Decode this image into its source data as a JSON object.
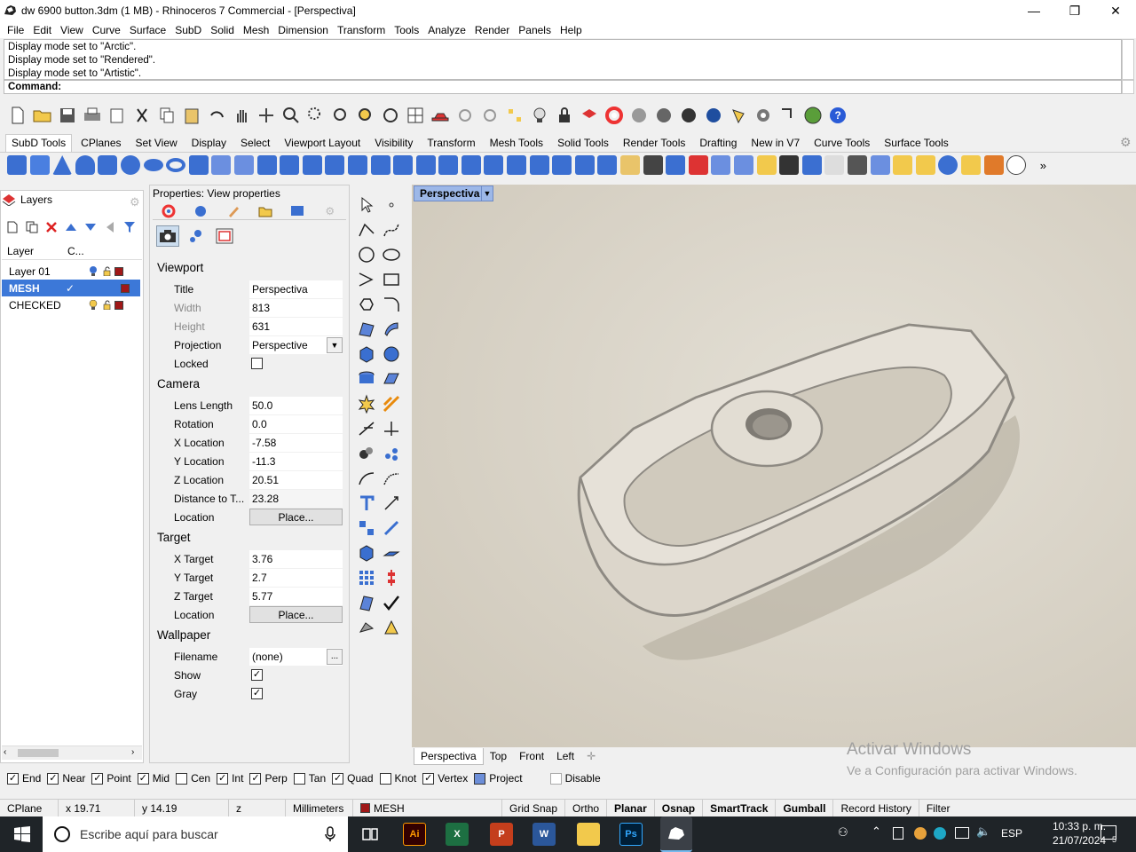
{
  "window": {
    "title": "dw 6900 button.3dm (1 MB) - Rhinoceros 7 Commercial - [Perspectiva]",
    "controls": [
      "—",
      "❐",
      "✕"
    ]
  },
  "menu": [
    "File",
    "Edit",
    "View",
    "Curve",
    "Surface",
    "SubD",
    "Solid",
    "Mesh",
    "Dimension",
    "Transform",
    "Tools",
    "Analyze",
    "Render",
    "Panels",
    "Help"
  ],
  "command": {
    "history": [
      "Display mode set to \"Arctic\".",
      "Display mode set to \"Rendered\".",
      "Display mode set to \"Artistic\"."
    ],
    "prompt": "Command:"
  },
  "toolbar_tabs": [
    {
      "label": "SubD Tools",
      "active": true
    },
    {
      "label": "CPlanes"
    },
    {
      "label": "Set View"
    },
    {
      "label": "Display"
    },
    {
      "label": "Select"
    },
    {
      "label": "Viewport Layout"
    },
    {
      "label": "Visibility"
    },
    {
      "label": "Transform"
    },
    {
      "label": "Mesh Tools"
    },
    {
      "label": "Solid Tools"
    },
    {
      "label": "Render Tools"
    },
    {
      "label": "Drafting"
    },
    {
      "label": "New in V7"
    },
    {
      "label": "Curve Tools"
    },
    {
      "label": "Surface Tools"
    }
  ],
  "layers": {
    "tab_label": "Layers",
    "col_layer": "Layer",
    "col_current": "C...",
    "rows": [
      {
        "name": "Layer 01",
        "current": "",
        "color": "#a01818",
        "selected": false
      },
      {
        "name": "MESH",
        "current": "✓",
        "color": "#a01818",
        "selected": true
      },
      {
        "name": "CHECKED",
        "current": "",
        "color": "#a01818",
        "selected": false
      }
    ]
  },
  "properties": {
    "title": "Properties: View properties",
    "viewport": {
      "section": "Viewport",
      "title_label": "Title",
      "title_value": "Perspectiva",
      "width_label": "Width",
      "width_value": "813",
      "height_label": "Height",
      "height_value": "631",
      "projection_label": "Projection",
      "projection_value": "Perspective",
      "locked_label": "Locked"
    },
    "camera": {
      "section": "Camera",
      "lens_label": "Lens Length",
      "lens_value": "50.0",
      "rotation_label": "Rotation",
      "rotation_value": "0.0",
      "xloc_label": "X Location",
      "xloc_value": "-7.58",
      "yloc_label": "Y Location",
      "yloc_value": "-11.3",
      "zloc_label": "Z Location",
      "zloc_value": "20.51",
      "dist_label": "Distance to T...",
      "dist_value": "23.28",
      "location_label": "Location",
      "place_button": "Place..."
    },
    "target": {
      "section": "Target",
      "xt_label": "X Target",
      "xt_value": "3.76",
      "yt_label": "Y Target",
      "yt_value": "2.7",
      "zt_label": "Z Target",
      "zt_value": "5.77",
      "location_label": "Location",
      "place_button": "Place..."
    },
    "wallpaper": {
      "section": "Wallpaper",
      "filename_label": "Filename",
      "filename_value": "(none)",
      "browse_button": "...",
      "show_label": "Show",
      "gray_label": "Gray"
    }
  },
  "viewport": {
    "label": "Perspectiva",
    "tabs": [
      "Perspectiva",
      "Top",
      "Front",
      "Left"
    ],
    "add_tab": "✛"
  },
  "watermark": {
    "line1": "Activar Windows",
    "line2": "Ve a Configuración para activar Windows."
  },
  "osnaps": [
    {
      "label": "End",
      "checked": true
    },
    {
      "label": "Near",
      "checked": true
    },
    {
      "label": "Point",
      "checked": true
    },
    {
      "label": "Mid",
      "checked": true
    },
    {
      "label": "Cen",
      "checked": false
    },
    {
      "label": "Int",
      "checked": true
    },
    {
      "label": "Perp",
      "checked": true
    },
    {
      "label": "Tan",
      "checked": false
    },
    {
      "label": "Quad",
      "checked": true
    },
    {
      "label": "Knot",
      "checked": false
    },
    {
      "label": "Vertex",
      "checked": true
    },
    {
      "label": "Project",
      "checked": false
    },
    {
      "label": "Disable",
      "checked": false
    }
  ],
  "status": {
    "cplane": "CPlane",
    "x": "x 19.71",
    "y": "y 14.19",
    "z": "z",
    "units": "Millimeters",
    "layer": "MESH",
    "layer_color": "#a01818",
    "toggles": [
      {
        "label": "Grid Snap",
        "bold": false
      },
      {
        "label": "Ortho",
        "bold": false
      },
      {
        "label": "Planar",
        "bold": true
      },
      {
        "label": "Osnap",
        "bold": true
      },
      {
        "label": "SmartTrack",
        "bold": true
      },
      {
        "label": "Gumball",
        "bold": true
      },
      {
        "label": "Record History",
        "bold": false
      },
      {
        "label": "Filter",
        "bold": false
      }
    ]
  },
  "taskbar": {
    "search_placeholder": "Escribe aquí para buscar",
    "lang": "ESP",
    "time": "10:33 p. m.",
    "date": "21/07/2024",
    "notif_count": "5"
  }
}
